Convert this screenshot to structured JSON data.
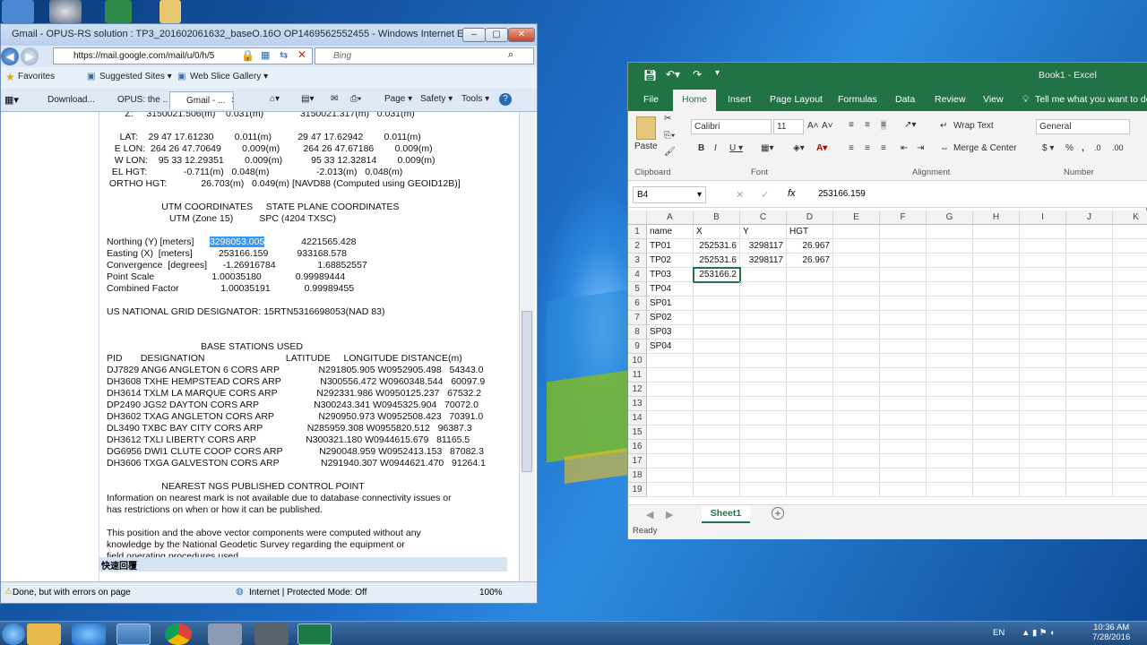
{
  "ie": {
    "title": "Gmail - OPUS-RS solution : TP3_201602061632_baseO.16O OP1469562552455 - Windows Internet Explorer",
    "address": "https://mail.google.com/mail/u/0/h/5",
    "search_placeholder": "Bing",
    "favorites": "Favorites",
    "suggested_sites": "Suggested Sites ▾",
    "web_slice": "Web Slice Gallery ▾",
    "tabs": [
      "Download...",
      "OPUS: the ...",
      "Gmail - ..."
    ],
    "commands": [
      "Page ▾",
      "Safety ▾",
      "Tools ▾",
      "?"
    ],
    "doc_lines": [
      "       Z:     3150021.506(m)    0.031(m)              3150021.317(m)   0.031(m)",
      "",
      "     LAT:    29 47 17.61230        0.011(m)          29 47 17.62942        0.011(m)",
      "   E LON:  264 26 47.70649        0.009(m)         264 26 47.67186        0.009(m)",
      "   W LON:    95 33 12.29351        0.009(m)           95 33 12.32814        0.009(m)",
      "  EL HGT:              -0.711(m)   0.048(m)                  -2.013(m)   0.048(m)",
      " ORTHO HGT:             26.703(m)   0.049(m) [NAVD88 (Computed using GEOID12B)]",
      "",
      "                     UTM COORDINATES     STATE PLANE COORDINATES",
      "                        UTM (Zone 15)          SPC (4204 TXSC)",
      "",
      "Easting (X)  [meters]          253166.159           933168.578",
      "Convergence  [degrees]      -1.26916784                1.68852557",
      "Point Scale                      1.00035180             0.99989444",
      "Combined Factor                1.00035191             0.99989455",
      "",
      "US NATIONAL GRID DESIGNATOR: 15RTN5316698053(NAD 83)",
      "",
      "",
      "                                    BASE STATIONS USED",
      "PID       DESIGNATION                               LATITUDE     LONGITUDE DISTANCE(m)",
      "DJ7829 ANG6 ANGLETON 6 CORS ARP               N291805.905 W0952905.498   54343.0",
      "DH3608 TXHE HEMPSTEAD CORS ARP               N300556.472 W0960348.544   60097.9",
      "DH3614 TXLM LA MARQUE CORS ARP               N292331.986 W0950125.237   67532.2",
      "DP2490 JGS2 DAYTON CORS ARP                     N300243.341 W0945325.904   70072.0",
      "DH3602 TXAG ANGLETON CORS ARP                 N290950.973 W0952508.423   70391.0",
      "DL3490 TXBC BAY CITY CORS ARP                 N285959.308 W0955820.512   96387.3",
      "DH3612 TXLI LIBERTY CORS ARP                   N300321.180 W0944615.679   81165.5",
      "DG6956 DWI1 CLUTE COOP CORS ARP              N290048.959 W0952413.153   87082.3",
      "DH3606 TXGA GALVESTON CORS ARP                N291940.307 W0944621.470   91264.1",
      "",
      "                     NEAREST NGS PUBLISHED CONTROL POINT",
      "Information on nearest mark is not available due to database connectivity issues or",
      "has restrictions on when or how it can be published.",
      "",
      "This position and the above vector components were computed without any",
      "knowledge by the National Geodetic Survey regarding the equipment or",
      "field operating procedures used."
    ],
    "northing_label": "Northing (Y) [meters]",
    "northing_value": "3298053.005",
    "northing_spc": "4221565.428",
    "footer_text": "快速回覆",
    "status_left": "Done, but with errors on page",
    "status_zone": "Internet | Protected Mode: Off",
    "zoom": "100%"
  },
  "excel": {
    "title": "Book1 - Excel",
    "ribbon_tabs": [
      "File",
      "Home",
      "Insert",
      "Page Layout",
      "Formulas",
      "Data",
      "Review",
      "View"
    ],
    "tell_me": "Tell me what you want to do",
    "font_name": "Calibri",
    "font_size": "11",
    "number_format": "General",
    "wrap_text": "Wrap Text",
    "merge_center": "Merge & Center",
    "paste": "Paste",
    "groups": [
      "Clipboard",
      "Font",
      "Alignment",
      "Number"
    ],
    "name_box": "B4",
    "formula": "253166.159",
    "columns": [
      "A",
      "B",
      "C",
      "D",
      "E",
      "F",
      "G",
      "H",
      "I",
      "J",
      "K"
    ],
    "rows": [
      [
        "name",
        "X",
        "Y",
        "HGT"
      ],
      [
        "TP01",
        "252531.6",
        "3298117",
        "26.967"
      ],
      [
        "TP02",
        "252531.6",
        "3298117",
        "26.967"
      ],
      [
        "TP03",
        "253166.2",
        "",
        ""
      ],
      [
        "TP04",
        "",
        "",
        ""
      ],
      [
        "SP01",
        "",
        "",
        ""
      ],
      [
        "SP02",
        "",
        "",
        ""
      ],
      [
        "SP03",
        "",
        "",
        ""
      ],
      [
        "SP04",
        "",
        "",
        ""
      ],
      [
        "",
        "",
        "",
        ""
      ],
      [
        "",
        "",
        "",
        ""
      ],
      [
        "",
        "",
        "",
        ""
      ],
      [
        "",
        "",
        "",
        ""
      ],
      [
        "",
        "",
        "",
        ""
      ],
      [
        "",
        "",
        "",
        ""
      ],
      [
        "",
        "",
        "",
        ""
      ],
      [
        "",
        "",
        "",
        ""
      ],
      [
        "",
        "",
        "",
        ""
      ],
      [
        "",
        "",
        "",
        ""
      ]
    ],
    "sheet": "Sheet1",
    "status": "Ready"
  },
  "taskbar": {
    "lang": "EN",
    "time": "10:36 AM",
    "date": "7/28/2016"
  }
}
